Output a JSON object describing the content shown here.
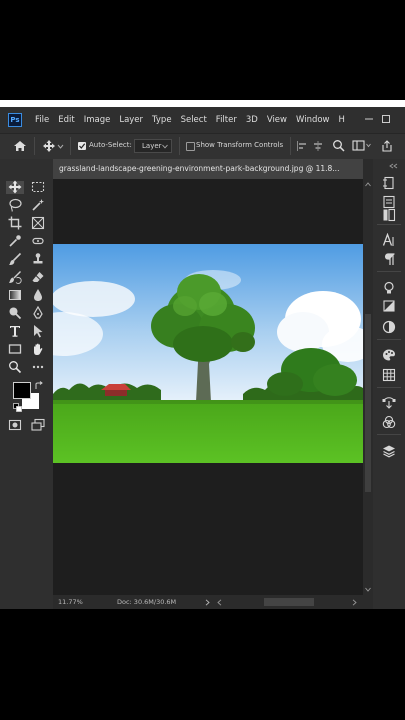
{
  "app": {
    "logo_text": "Ps"
  },
  "menu": [
    "File",
    "Edit",
    "Image",
    "Layer",
    "Type",
    "Select",
    "Filter",
    "3D",
    "View",
    "Window",
    "H"
  ],
  "options": {
    "auto_select_label": "Auto-Select:",
    "auto_select_checked": true,
    "layer_select_value": "Layer",
    "transform_label": "Show Transform Controls",
    "transform_checked": false
  },
  "document": {
    "tab_title": "grassland-landscape-greening-environment-park-background.jpg @ 11.8..."
  },
  "status": {
    "zoom": "11.77%",
    "doc_info": "Doc: 30.6M/30.6M"
  },
  "colors": {
    "accent": "#31a8ff",
    "foreground_color": "#000000",
    "background_color": "#ffffff"
  }
}
